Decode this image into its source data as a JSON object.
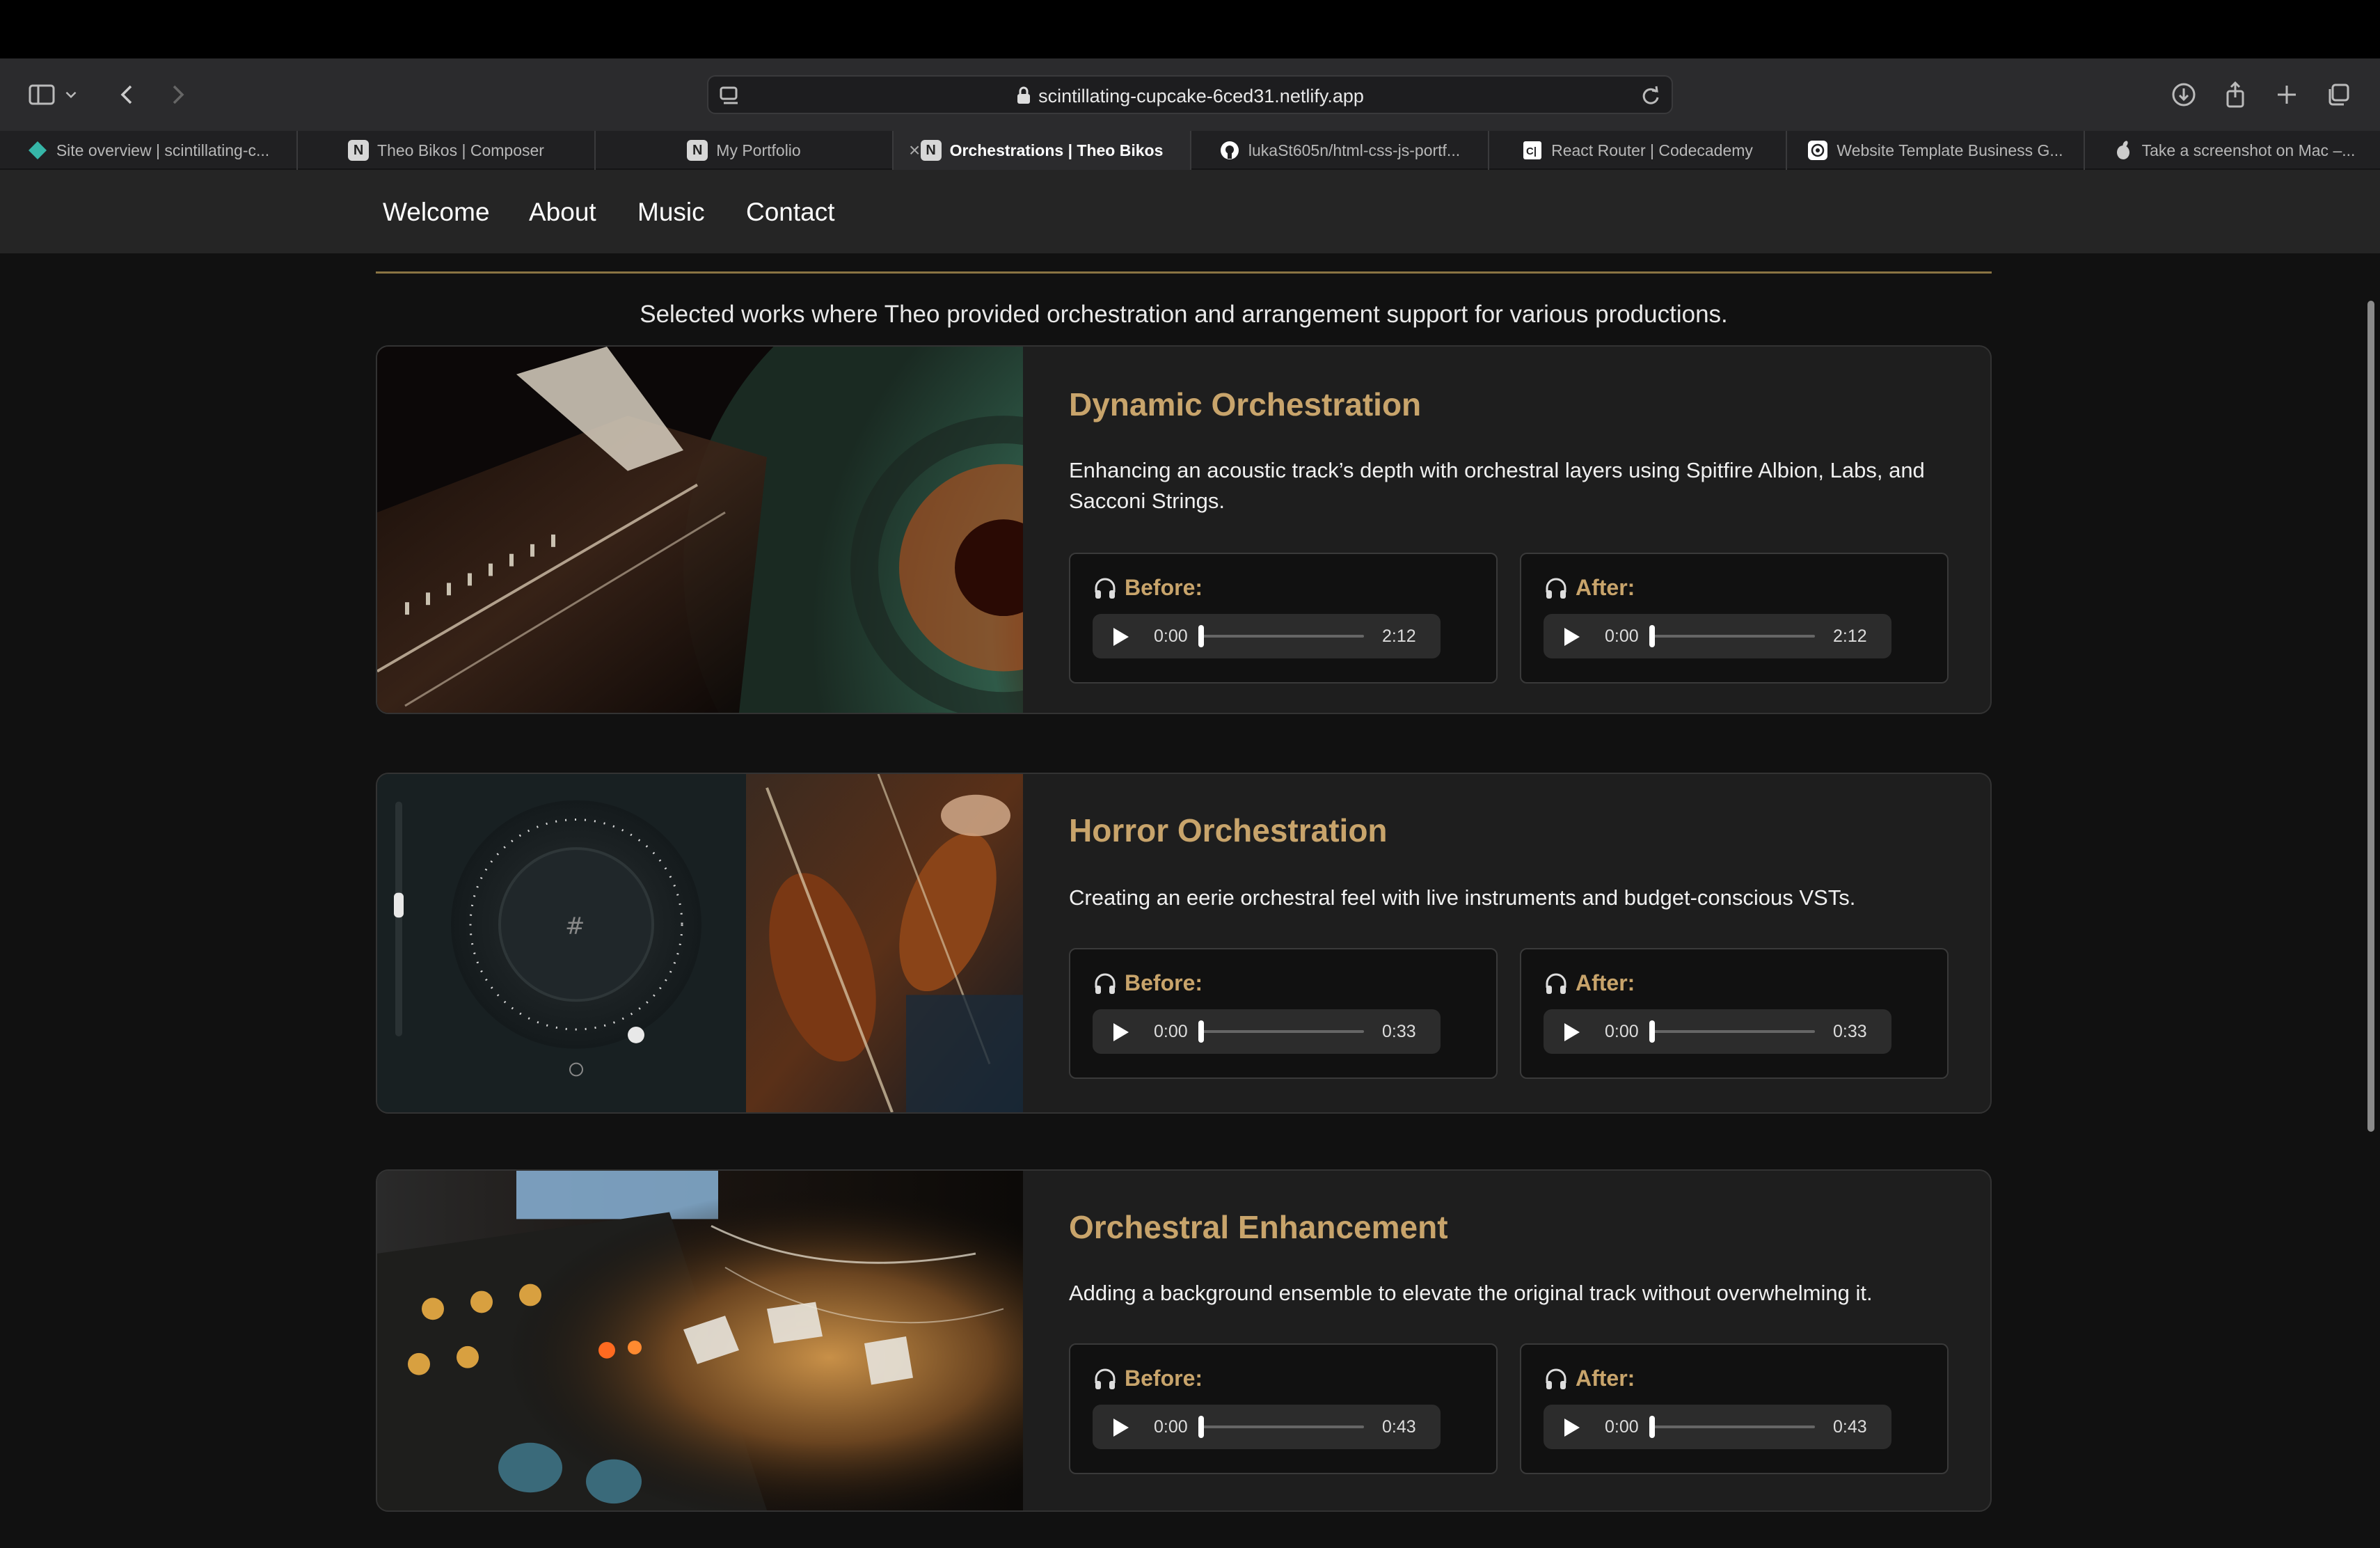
{
  "browser": {
    "url": "scintillating-cupcake-6ced31.netlify.app",
    "tabs": [
      {
        "title": "Site overview | scintillating-c...",
        "favicon": "netlify-icon",
        "color": "#36b6a8"
      },
      {
        "title": "Theo Bikos | Composer",
        "favicon": "N",
        "color": "#d7d7d7"
      },
      {
        "title": "My Portfolio",
        "favicon": "N",
        "color": "#d7d7d7"
      },
      {
        "title": "Orchestrations | Theo Bikos",
        "favicon": "N",
        "color": "#d7d7d7",
        "active": true
      },
      {
        "title": "lukaSt605n/html-css-js-portf...",
        "favicon": "github-icon",
        "color": "#ffffff"
      },
      {
        "title": "React Router | Codecademy",
        "favicon": "codecademy-icon",
        "color": "#ffffff"
      },
      {
        "title": "Website Template Business G...",
        "favicon": "openai-icon",
        "color": "#ffffff"
      },
      {
        "title": "Take a screenshot on Mac –...",
        "favicon": "apple-icon",
        "color": "#cccccc"
      }
    ]
  },
  "nav": {
    "welcome": "Welcome",
    "about": "About",
    "music": "Music",
    "contact": "Contact"
  },
  "intro": "Selected works where Theo provided orchestration and arrangement support for various productions.",
  "projects": [
    {
      "title": "Dynamic Orchestration",
      "description": "Enhancing an acoustic track’s depth with orchestral layers using Spitfire Albion, Labs, and Sacconi Strings.",
      "before": {
        "label": "Before:",
        "current": "0:00",
        "duration": "2:12"
      },
      "after": {
        "label": "After:",
        "current": "0:00",
        "duration": "2:12"
      }
    },
    {
      "title": "Horror Orchestration",
      "description": "Creating an eerie orchestral feel with live instruments and budget-conscious VSTs.",
      "before": {
        "label": "Before:",
        "current": "0:00",
        "duration": "0:33"
      },
      "after": {
        "label": "After:",
        "current": "0:00",
        "duration": "0:33"
      }
    },
    {
      "title": "Orchestral Enhancement",
      "description": "Adding a background ensemble to elevate the original track without overwhelming it.",
      "before": {
        "label": "Before:",
        "current": "0:00",
        "duration": "0:43"
      },
      "after": {
        "label": "After:",
        "current": "0:00",
        "duration": "0:43"
      }
    }
  ],
  "colors": {
    "accent": "#c8a46b",
    "background": "#111111",
    "card": "#1e1e1e"
  }
}
